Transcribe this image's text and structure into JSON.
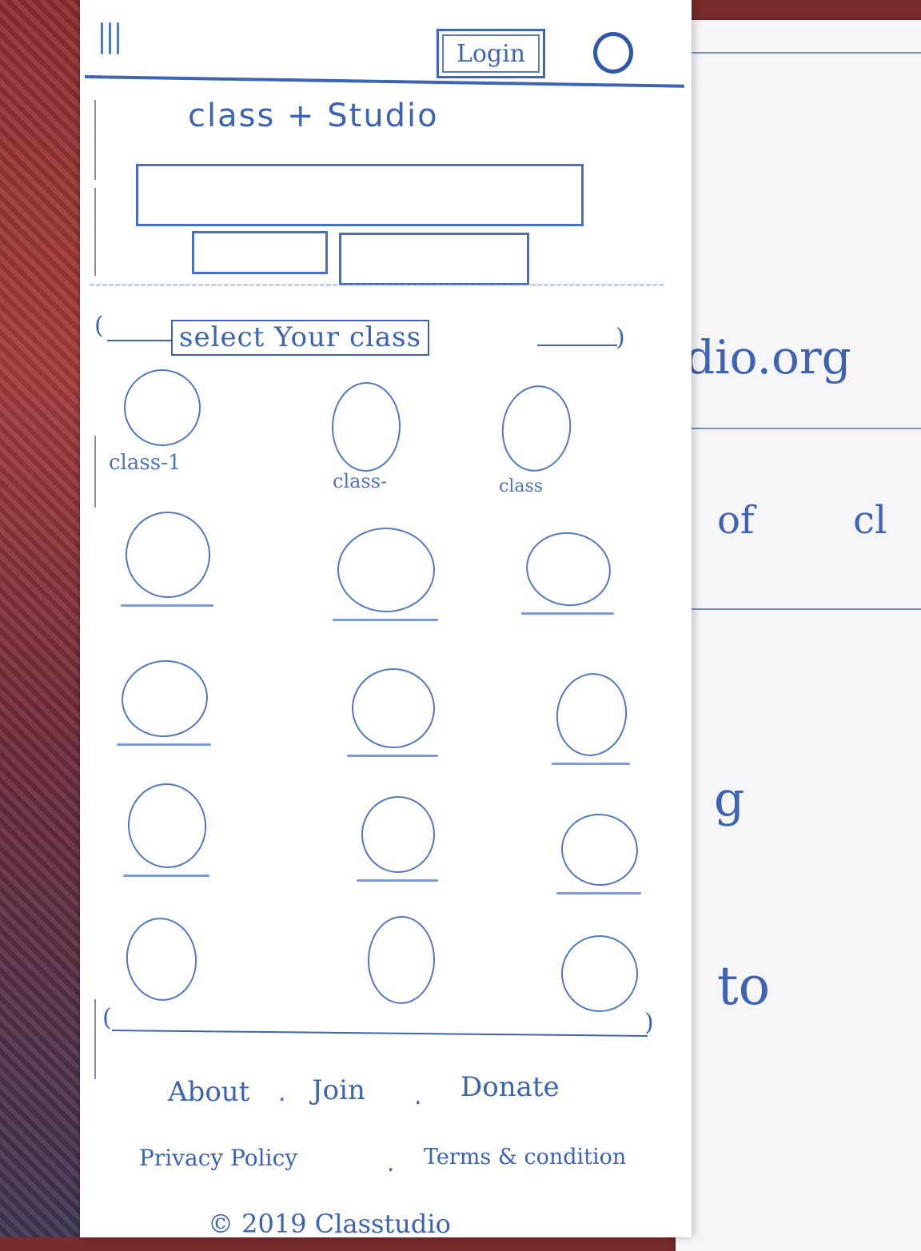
{
  "header": {
    "menu_icon": "hamburger-menu-icon",
    "login_label": "Login",
    "profile_icon": "user-circle-icon"
  },
  "brand": {
    "title": "class + Studio"
  },
  "section": {
    "heading": "select Your class"
  },
  "classes": [
    {
      "label": "class-1"
    },
    {
      "label": "class-"
    },
    {
      "label": "class"
    }
  ],
  "footer": {
    "links": [
      "About",
      "Join",
      "Donate"
    ],
    "legal_links": [
      "Privacy Policy",
      "Terms & condition"
    ],
    "separator": ".",
    "copyright": "© 2019 Classtudio"
  },
  "background_sheet": {
    "fragments": [
      "dio.org",
      "of",
      "cl",
      "g",
      "to"
    ]
  },
  "colors": {
    "ink": "#3b62b5",
    "paper": "#ffffff"
  }
}
